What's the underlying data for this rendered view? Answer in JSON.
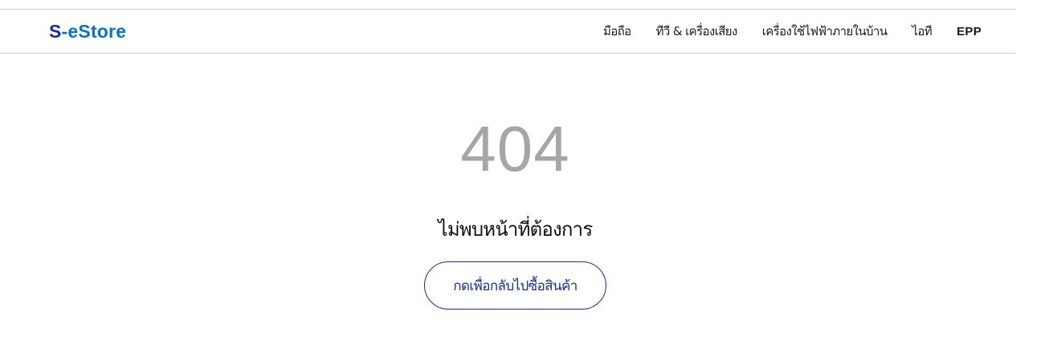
{
  "header": {
    "logo_s": "S",
    "logo_rest": "-eStore",
    "nav": [
      "มือถือ",
      "ทีวี & เครื่องเสียง",
      "เครื่องใช้ไฟฟ้าภายในบ้าน",
      "ไอที",
      "EPP"
    ]
  },
  "error": {
    "code": "404",
    "message": "ไม่พบหน้าที่ต้องการ",
    "button_label": "กดเพื่อกลับไปซื้อสินค้า"
  },
  "colors": {
    "brand_blue": "#1a2f8c",
    "logo_light_blue": "#0a72c2",
    "code_gray": "#a6a6a6"
  }
}
